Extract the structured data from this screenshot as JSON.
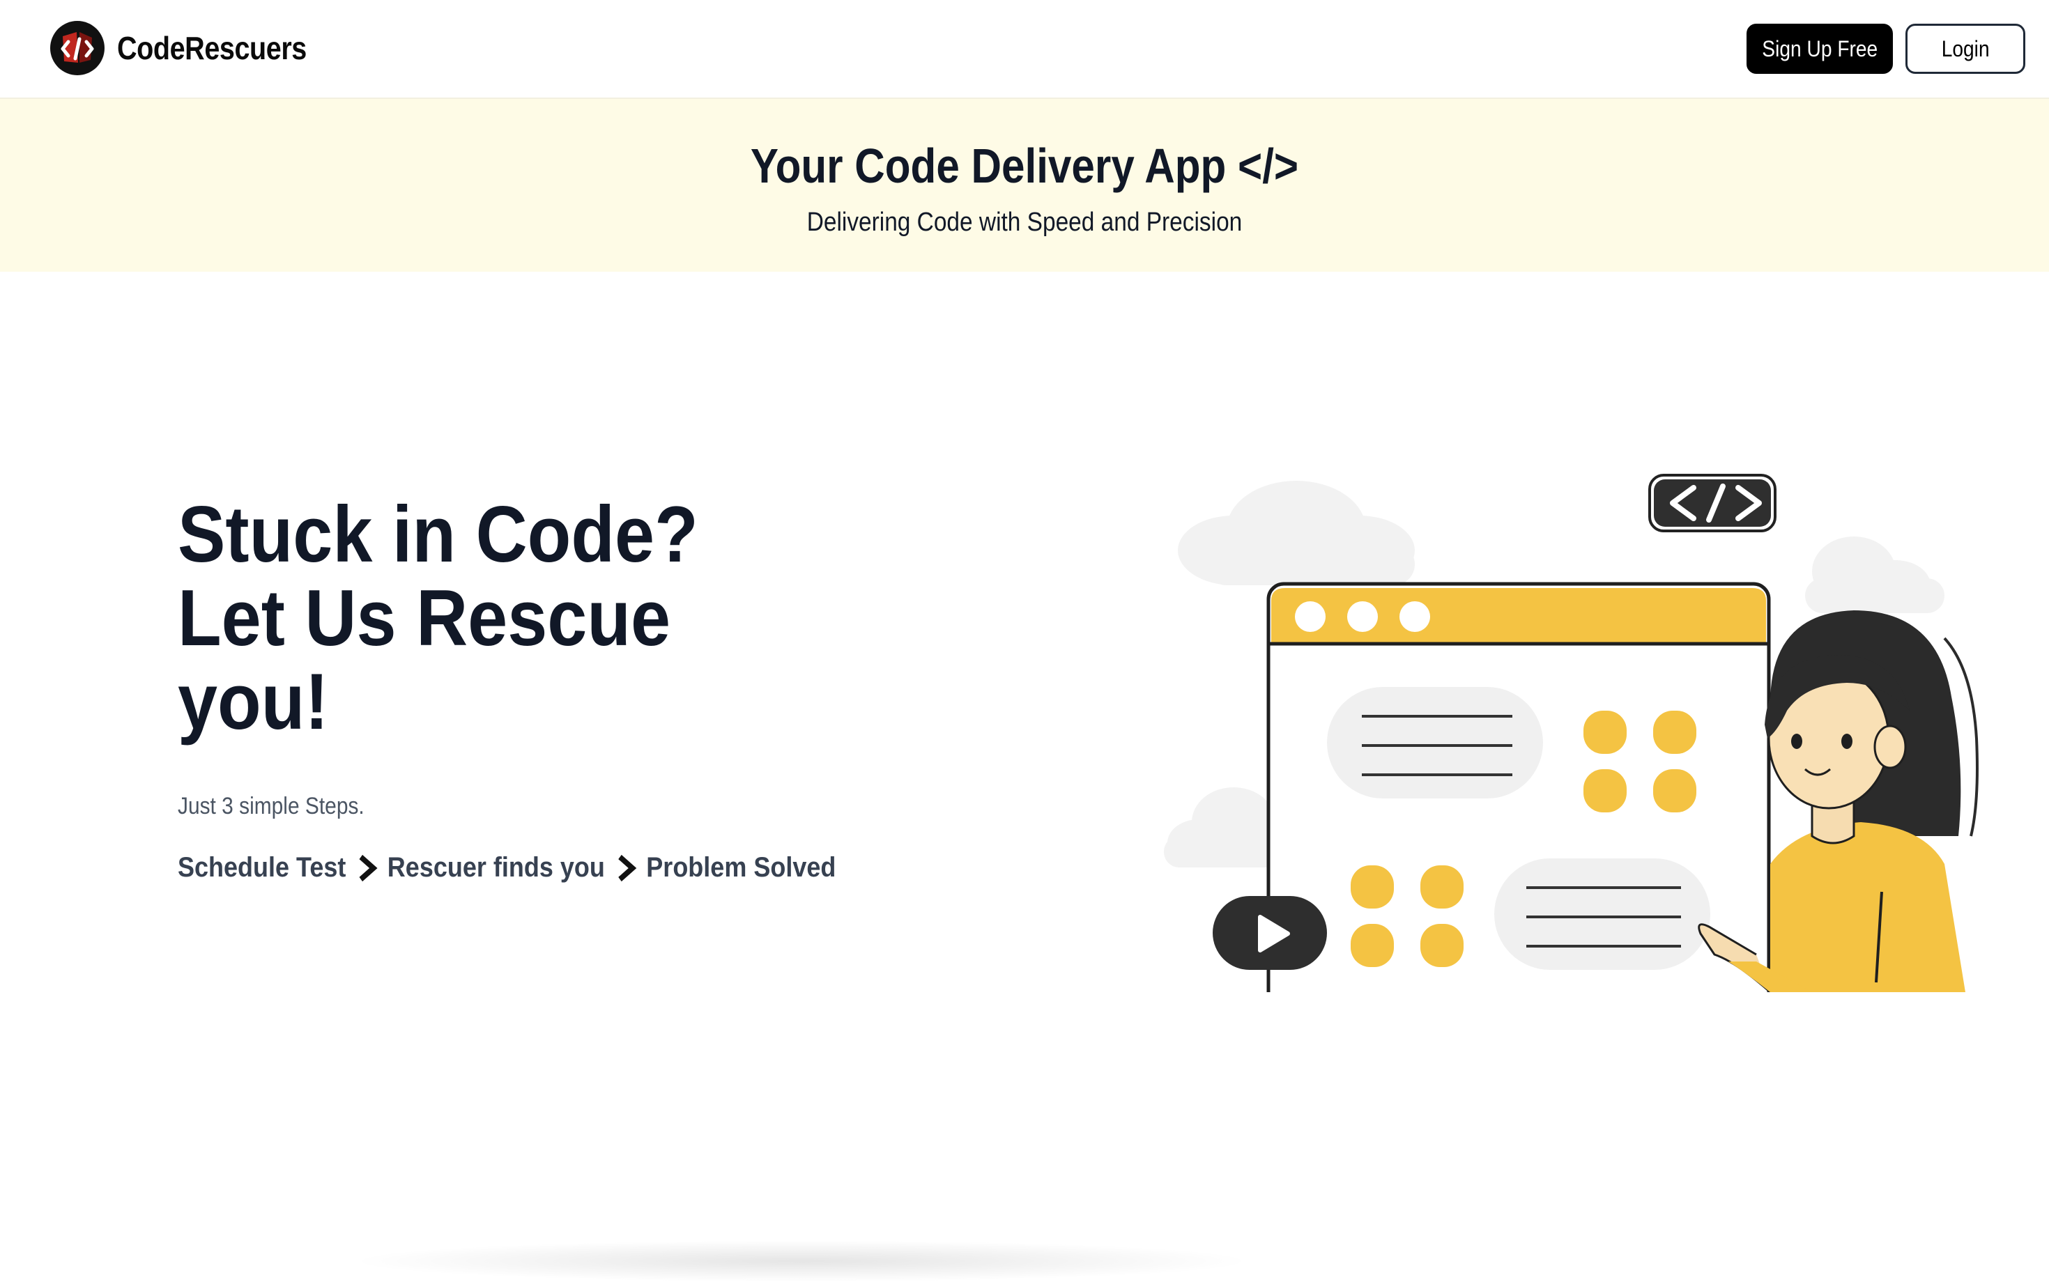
{
  "navbar": {
    "brand_name": "CodeRescuers",
    "signup_label": "Sign Up Free",
    "login_label": "Login"
  },
  "banner": {
    "title": "Your Code Delivery App </>",
    "subtitle": "Delivering Code with Speed and Precision"
  },
  "hero": {
    "heading_lines": [
      "Stuck in Code?",
      "Let Us Rescue",
      "you!"
    ],
    "tagline": "Just 3 simple Steps.",
    "steps": [
      "Schedule Test",
      "Rescuer finds you",
      "Problem Solved"
    ]
  },
  "illustration": {
    "code_tag": "</>",
    "icons": [
      "code-tag-icon",
      "play-icon",
      "pointing-hand-icon"
    ]
  },
  "colors": {
    "accent_yellow": "#f4c343",
    "banner_bg": "#fefbe6",
    "heading": "#111827",
    "button_dark": "#000000",
    "logo_red": "#c0271f"
  }
}
